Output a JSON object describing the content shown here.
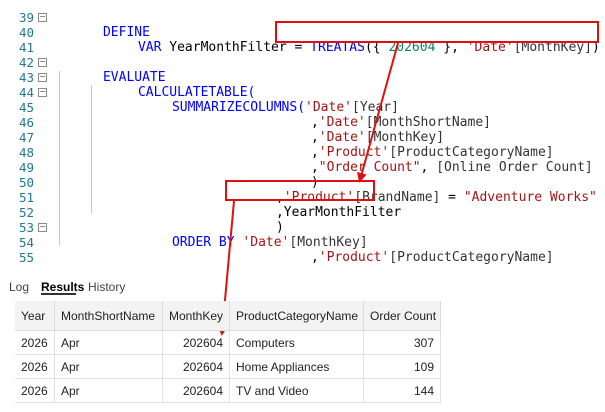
{
  "editor": {
    "lines": [
      {
        "n": "39",
        "fold": "minus"
      },
      {
        "n": "40"
      },
      {
        "n": "41"
      },
      {
        "n": "42",
        "fold": "minus"
      },
      {
        "n": "43",
        "fold": "minus"
      },
      {
        "n": "44",
        "fold": "minus"
      },
      {
        "n": "45"
      },
      {
        "n": "46"
      },
      {
        "n": "47"
      },
      {
        "n": "48"
      },
      {
        "n": "49"
      },
      {
        "n": "50"
      },
      {
        "n": "51"
      },
      {
        "n": "52"
      },
      {
        "n": "53",
        "fold": "minus"
      },
      {
        "n": "54"
      },
      {
        "n": "55"
      }
    ],
    "tokens": {
      "define": "DEFINE",
      "var": "VAR",
      "var_name": "YearMonthFilter",
      "eq": " = ",
      "treatas": "TREATAS",
      "treatas_open": "({ ",
      "month_value": "202604",
      "treatas_mid": " }, ",
      "date_table": "'Date'",
      "monthkey_col": "[MonthKey]",
      "close_paren": ")",
      "evaluate": "EVALUATE",
      "calculatetable": "CALCULATETABLE(",
      "summarizecolumns": "SUMMARIZECOLUMNS(",
      "year_col": "[Year]",
      "monthshort_col": "[MonthShortName]",
      "product_table": "'Product'",
      "prodcat_col": "[ProductCategoryName]",
      "order_count_str": "\"Order Count\"",
      "online_order_measure": "[Online Order Count]",
      "brand_col": "[BrandName]",
      "adventure_works_str": "\"Adventure Works\"",
      "filter_ref": ",YearMonthFilter",
      "order_by": "ORDER BY",
      "comma": ",",
      "paren_close": ")"
    }
  },
  "tabs": [
    {
      "label": "Log",
      "active": false
    },
    {
      "label": "Results",
      "active": true
    },
    {
      "label": "History",
      "active": false
    }
  ],
  "results": {
    "columns": [
      "Year",
      "MonthShortName",
      "MonthKey",
      "ProductCategoryName",
      "Order Count"
    ],
    "rows": [
      [
        "2026",
        "Apr",
        "202604",
        "Computers",
        "307"
      ],
      [
        "2026",
        "Apr",
        "202604",
        "Home Appliances",
        "109"
      ],
      [
        "2026",
        "Apr",
        "202604",
        "TV and Video",
        "144"
      ]
    ]
  },
  "colors": {
    "keyword": "#0000ff",
    "string": "#a31515",
    "number": "#098658",
    "line_number": "#237893",
    "annotation": "#e01010"
  }
}
